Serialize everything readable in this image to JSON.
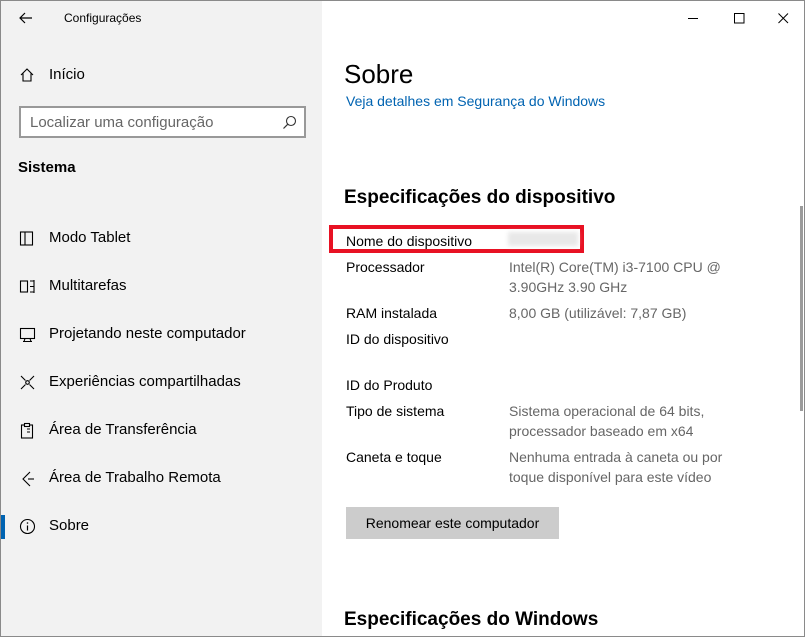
{
  "window": {
    "app_title": "Configurações",
    "controls": {
      "minimize": "minimize",
      "maximize": "maximize",
      "close": "close"
    }
  },
  "sidebar": {
    "home_label": "Início",
    "search_placeholder": "Localizar uma configuração",
    "section_title": "Sistema",
    "items": [
      {
        "label": "Modo Tablet",
        "icon": "tablet-mode-icon"
      },
      {
        "label": "Multitarefas",
        "icon": "multitasking-icon"
      },
      {
        "label": "Projetando neste computador",
        "icon": "projecting-icon"
      },
      {
        "label": "Experiências compartilhadas",
        "icon": "shared-experiences-icon"
      },
      {
        "label": "Área de Transferência",
        "icon": "clipboard-icon"
      },
      {
        "label": "Área de Trabalho Remota",
        "icon": "remote-desktop-icon"
      },
      {
        "label": "Sobre",
        "icon": "info-icon",
        "active": true
      }
    ]
  },
  "main": {
    "page_title": "Sobre",
    "security_link": "Veja detalhes em Segurança do Windows",
    "device_specs_heading": "Especificações do dispositivo",
    "specs": [
      {
        "label": "Nome do dispositivo",
        "value": ""
      },
      {
        "label": "Processador",
        "value_lines": [
          "Intel(R) Core(TM) i3-7100 CPU @",
          "3.90GHz   3.90 GHz"
        ]
      },
      {
        "label": "RAM instalada",
        "value_lines": [
          "8,00 GB (utilizável: 7,87 GB)"
        ]
      },
      {
        "label": "ID do dispositivo",
        "value_lines": []
      },
      {
        "label": "ID do Produto",
        "value_lines": []
      },
      {
        "label": "Tipo de sistema",
        "value_lines": [
          "Sistema operacional de 64 bits,",
          "processador baseado em x64"
        ]
      },
      {
        "label": "Caneta e toque",
        "value_lines": [
          "Nenhuma entrada à caneta ou por",
          "toque disponível para este vídeo"
        ]
      }
    ],
    "rename_button": "Renomear este computador",
    "windows_specs_heading": "Especificações do Windows"
  },
  "colors": {
    "accent": "#0063b1",
    "highlight_border": "#e81123",
    "sidebar_bg": "#f2f2f2"
  }
}
